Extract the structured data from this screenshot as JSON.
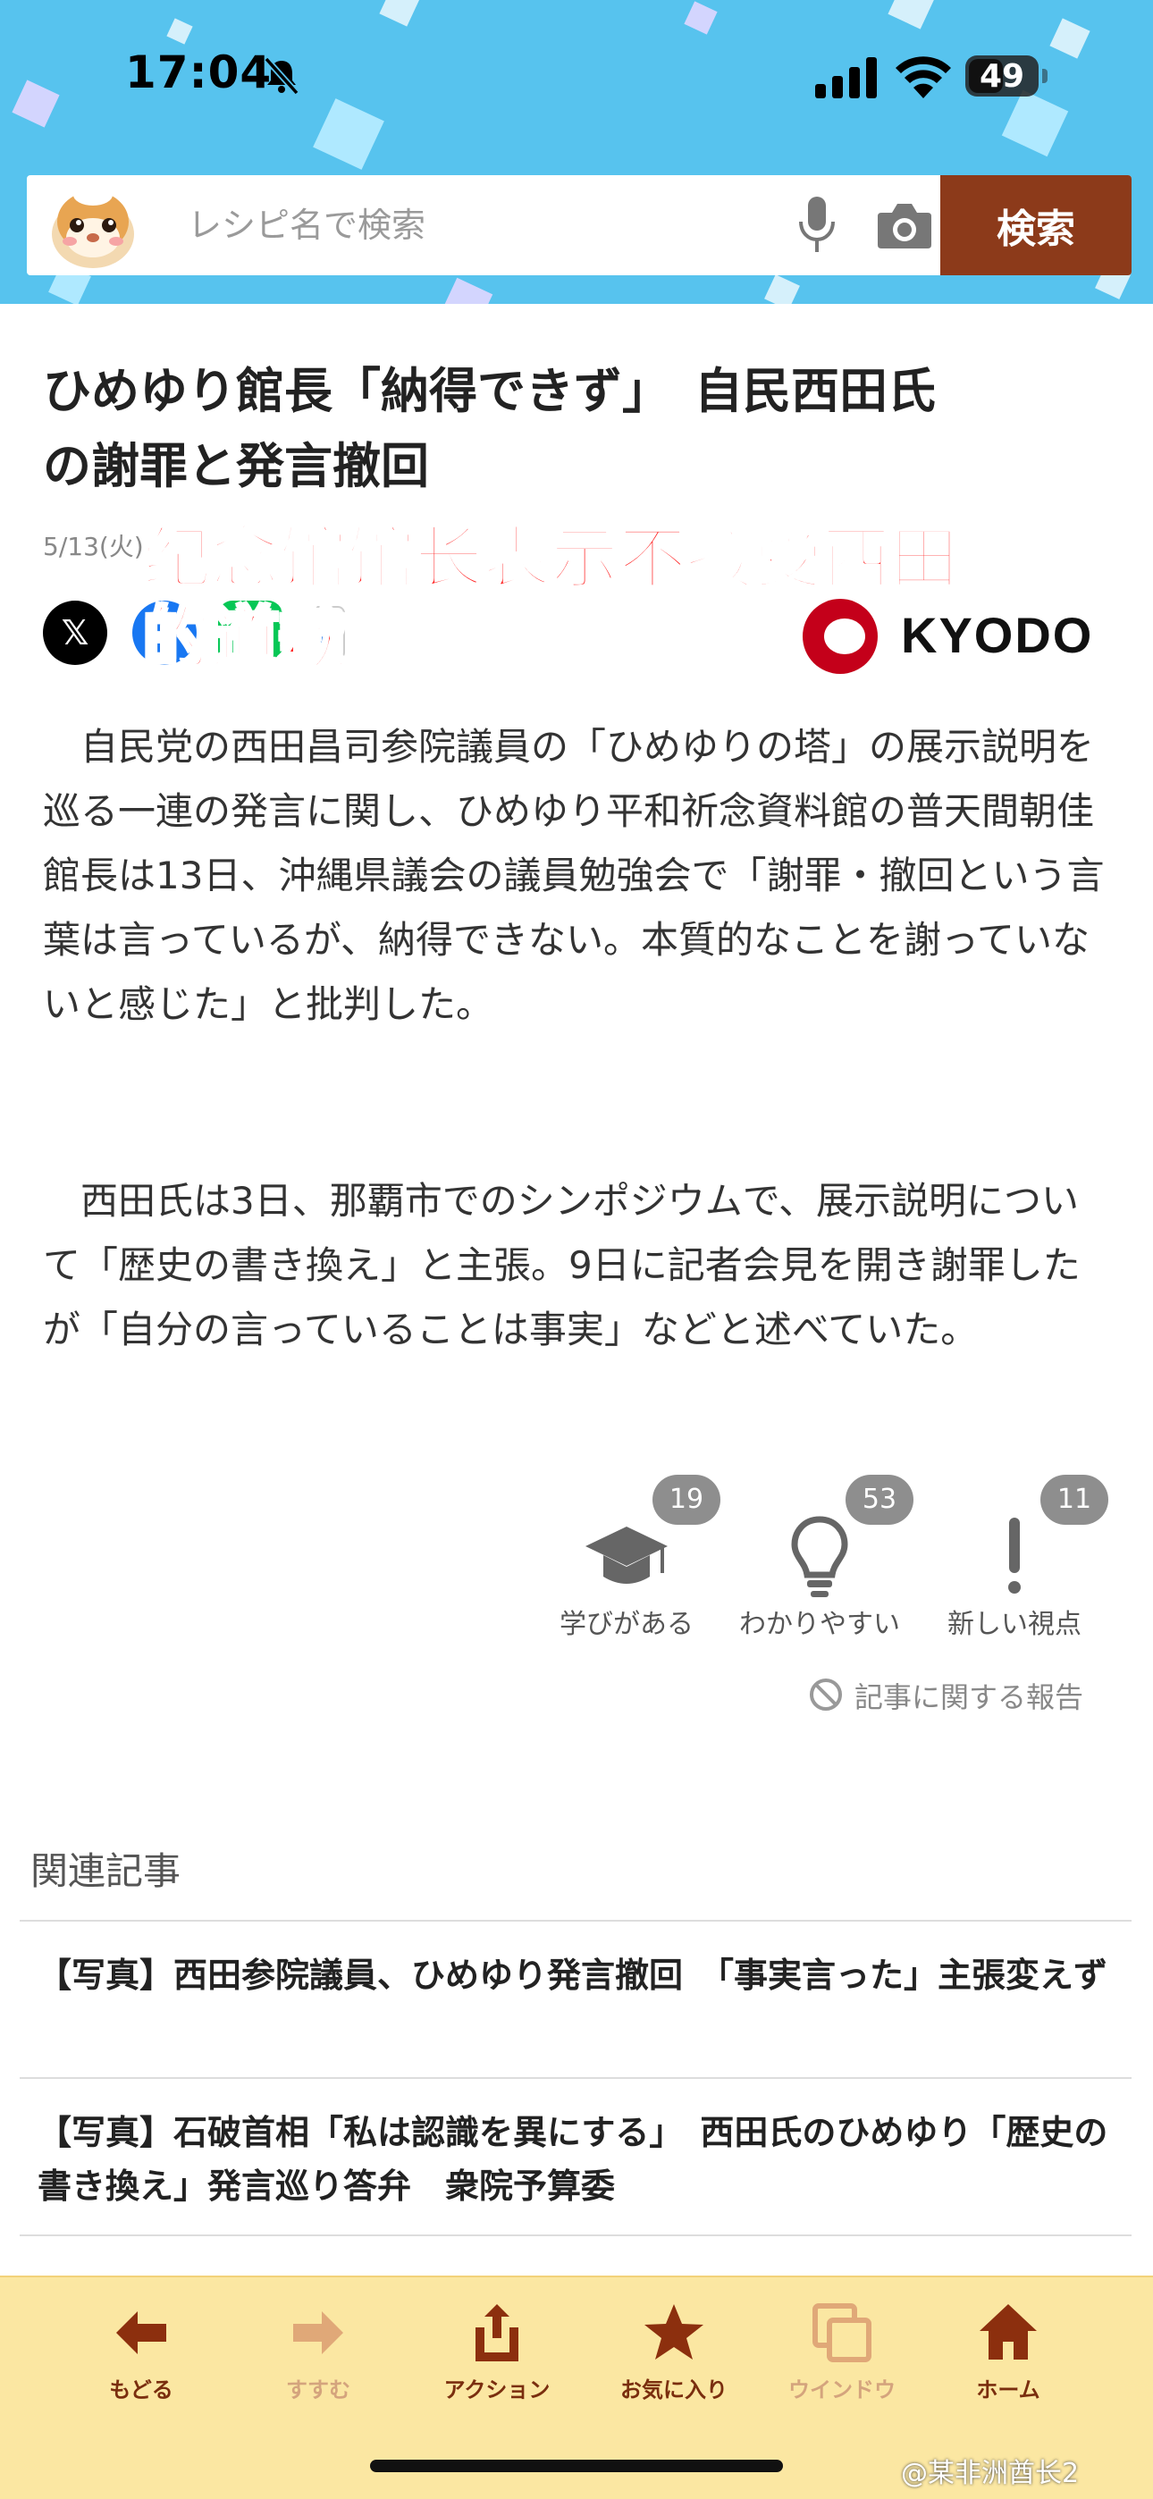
{
  "status_bar": {
    "time": "17:04",
    "battery": "49"
  },
  "search": {
    "placeholder": "レシピ名で検索",
    "button": "検索"
  },
  "article": {
    "title": "ひめゆり館長「納得できず」　自民西田氏\nの謝罪と発言撤回",
    "date": "5/13(火)",
    "source_logo": "KYODO",
    "share_x": "𝕏",
    "share_more": "↕",
    "overlay_caption": "纪念馆馆长表示不接受西田\n的道歉",
    "paragraphs": [
      "　自民党の西田昌司参院議員の「ひめゆりの塔」の展示説明を巡る一連の発言に関し、ひめゆり平和祈念資料館の普天間朝佳館長は13日、沖縄県議会の議員勉強会で「謝罪・撤回という言葉は言っているが、納得できない。本質的なことを謝っていないと感じた」と批判した。",
      "　西田氏は3日、那覇市でのシンポジウムで、展示説明について「歴史の書き換え」と主張。9日に記者会見を開き謝罪したが「自分の言っていることは事実」などと述べていた。"
    ]
  },
  "reactions": [
    {
      "label": "学びがある",
      "count": "19",
      "icon": "graduation-cap-icon"
    },
    {
      "label": "わかりやすい",
      "count": "53",
      "icon": "lightbulb-icon"
    },
    {
      "label": "新しい視点",
      "count": "11",
      "icon": "exclamation-icon"
    }
  ],
  "report_link": "記事に関する報告",
  "related": {
    "heading": "関連記事",
    "items": [
      "【写真】西田参院議員、ひめゆり発言撤回　「事実言った」主張変えず",
      "【写真】石破首相「私は認識を異にする」　西田氏のひめゆり「歴史の書き換え」発言巡り答弁　衆院予算委"
    ]
  },
  "toolbar": [
    {
      "label": "もどる",
      "icon": "arrow-left-icon",
      "enabled": true
    },
    {
      "label": "すすむ",
      "icon": "arrow-right-icon",
      "enabled": false
    },
    {
      "label": "アクション",
      "icon": "share-icon",
      "enabled": true
    },
    {
      "label": "お気に入り",
      "icon": "star-icon",
      "enabled": true
    },
    {
      "label": "ウインドウ",
      "icon": "windows-icon",
      "enabled": false
    },
    {
      "label": "ホーム",
      "icon": "home-icon",
      "enabled": true
    }
  ],
  "watermark": "@某非洲酋长2",
  "colors": {
    "header_bg": "#57c3ee",
    "search_button": "#8c3a1a",
    "toolbar_bg": "#fbe7a2",
    "toolbar_label": "#7a2e0e",
    "overlay_text": "#ff2020"
  }
}
